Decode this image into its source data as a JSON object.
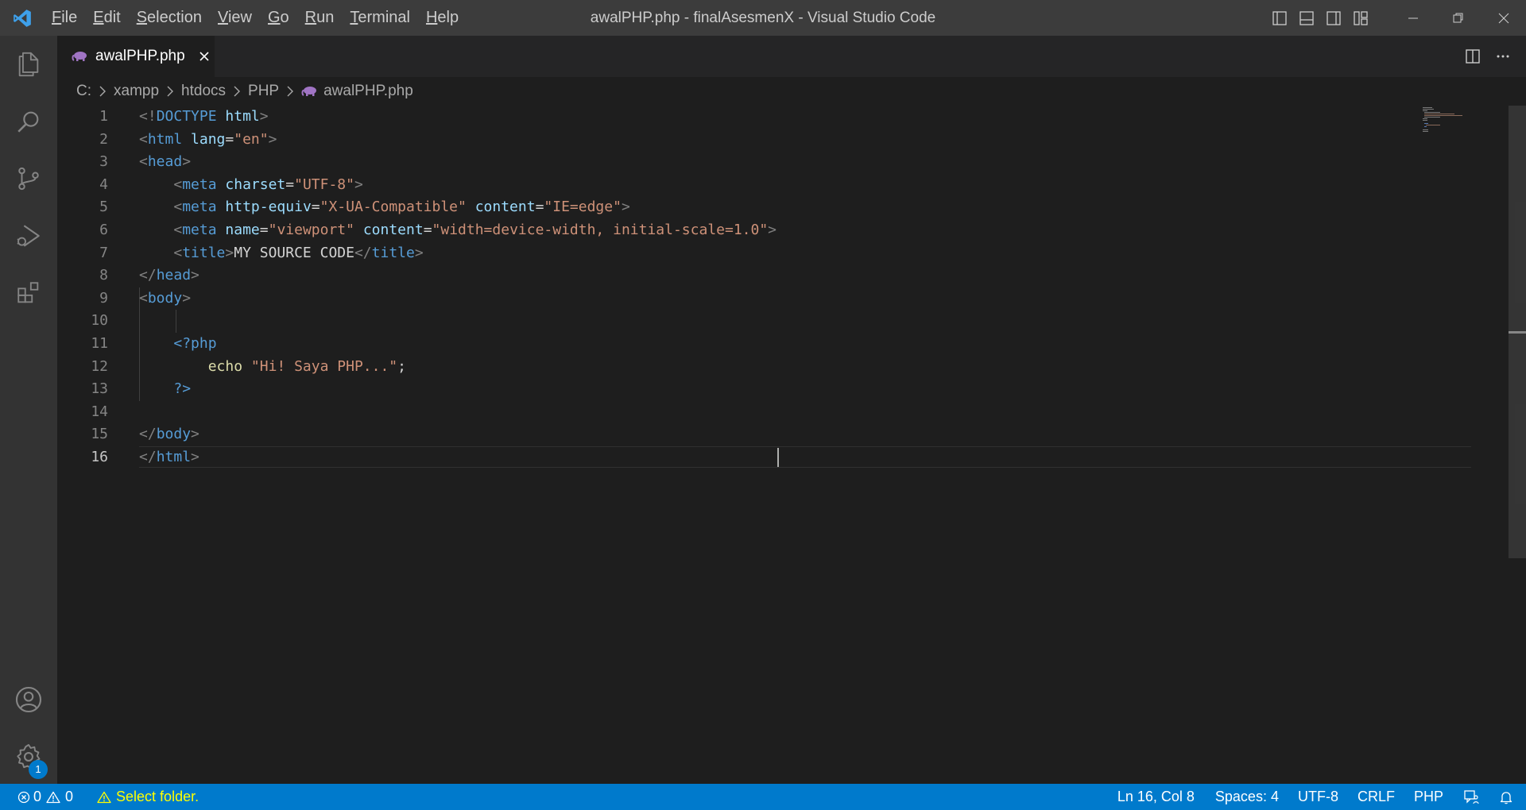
{
  "window": {
    "title": "awalPHP.php - finalAsesmenX - Visual Studio Code"
  },
  "menu": {
    "items": [
      {
        "label": "File",
        "mnemonic": "F",
        "rest": "ile"
      },
      {
        "label": "Edit",
        "mnemonic": "E",
        "rest": "dit"
      },
      {
        "label": "Selection",
        "mnemonic": "S",
        "rest": "election"
      },
      {
        "label": "View",
        "mnemonic": "V",
        "rest": "iew"
      },
      {
        "label": "Go",
        "mnemonic": "G",
        "rest": "o"
      },
      {
        "label": "Run",
        "mnemonic": "R",
        "rest": "un"
      },
      {
        "label": "Terminal",
        "mnemonic": "T",
        "rest": "erminal"
      },
      {
        "label": "Help",
        "mnemonic": "H",
        "rest": "elp"
      }
    ]
  },
  "activity_bar": {
    "icons": [
      "explorer-icon",
      "search-icon",
      "source-control-icon",
      "run-debug-icon",
      "extensions-icon",
      "account-icon",
      "manage-gear-icon"
    ],
    "settings_badge": "1"
  },
  "tab": {
    "label": "awalPHP.php",
    "icon": "php-elephant-icon"
  },
  "breadcrumb": {
    "segments": [
      "C:",
      "xampp",
      "htdocs",
      "PHP",
      "awalPHP.php"
    ]
  },
  "editor": {
    "active_line": 16,
    "line_numbers": [
      "1",
      "2",
      "3",
      "4",
      "5",
      "6",
      "7",
      "8",
      "9",
      "10",
      "11",
      "12",
      "13",
      "14",
      "15",
      "16"
    ],
    "lines": [
      [
        [
          "p",
          "<!"
        ],
        [
          "t",
          "DOCTYPE"
        ],
        [
          "x",
          " "
        ],
        [
          "a",
          "html"
        ],
        [
          "p",
          ">"
        ]
      ],
      [
        [
          "p",
          "<"
        ],
        [
          "t",
          "html"
        ],
        [
          "x",
          " "
        ],
        [
          "a",
          "lang"
        ],
        [
          "x",
          "="
        ],
        [
          "s",
          "\"en\""
        ],
        [
          "p",
          ">"
        ]
      ],
      [
        [
          "p",
          "<"
        ],
        [
          "t",
          "head"
        ],
        [
          "p",
          ">"
        ]
      ],
      [
        [
          "x",
          "    "
        ],
        [
          "p",
          "<"
        ],
        [
          "t",
          "meta"
        ],
        [
          "x",
          " "
        ],
        [
          "a",
          "charset"
        ],
        [
          "x",
          "="
        ],
        [
          "s",
          "\"UTF-8\""
        ],
        [
          "p",
          ">"
        ]
      ],
      [
        [
          "x",
          "    "
        ],
        [
          "p",
          "<"
        ],
        [
          "t",
          "meta"
        ],
        [
          "x",
          " "
        ],
        [
          "a",
          "http-equiv"
        ],
        [
          "x",
          "="
        ],
        [
          "s",
          "\"X-UA-Compatible\""
        ],
        [
          "x",
          " "
        ],
        [
          "a",
          "content"
        ],
        [
          "x",
          "="
        ],
        [
          "s",
          "\"IE=edge\""
        ],
        [
          "p",
          ">"
        ]
      ],
      [
        [
          "x",
          "    "
        ],
        [
          "p",
          "<"
        ],
        [
          "t",
          "meta"
        ],
        [
          "x",
          " "
        ],
        [
          "a",
          "name"
        ],
        [
          "x",
          "="
        ],
        [
          "s",
          "\"viewport\""
        ],
        [
          "x",
          " "
        ],
        [
          "a",
          "content"
        ],
        [
          "x",
          "="
        ],
        [
          "s",
          "\"width=device-width, initial-scale=1.0\""
        ],
        [
          "p",
          ">"
        ]
      ],
      [
        [
          "x",
          "    "
        ],
        [
          "p",
          "<"
        ],
        [
          "t",
          "title"
        ],
        [
          "p",
          ">"
        ],
        [
          "x",
          "MY SOURCE CODE"
        ],
        [
          "p",
          "</"
        ],
        [
          "t",
          "title"
        ],
        [
          "p",
          ">"
        ]
      ],
      [
        [
          "p",
          "</"
        ],
        [
          "t",
          "head"
        ],
        [
          "p",
          ">"
        ]
      ],
      [
        [
          "p",
          "<"
        ],
        [
          "t",
          "body"
        ],
        [
          "p",
          ">"
        ]
      ],
      [
        [
          "x",
          ""
        ]
      ],
      [
        [
          "x",
          "    "
        ],
        [
          "k",
          "<?php"
        ]
      ],
      [
        [
          "x",
          "        "
        ],
        [
          "f",
          "echo"
        ],
        [
          "x",
          " "
        ],
        [
          "s",
          "\"Hi! Saya PHP...\""
        ],
        [
          "x",
          ";"
        ]
      ],
      [
        [
          "x",
          "    "
        ],
        [
          "k",
          "?>"
        ]
      ],
      [
        [
          "x",
          ""
        ]
      ],
      [
        [
          "p",
          "</"
        ],
        [
          "t",
          "body"
        ],
        [
          "p",
          ">"
        ]
      ],
      [
        [
          "p",
          "</"
        ],
        [
          "t",
          "html"
        ],
        [
          "p",
          ">"
        ]
      ]
    ]
  },
  "status_bar": {
    "errors": "0",
    "warnings": "0",
    "folder_message": "Select folder.",
    "position": "Ln 16, Col 8",
    "spaces": "Spaces: 4",
    "encoding": "UTF-8",
    "eol": "CRLF",
    "language": "PHP"
  },
  "colors": {
    "status_bar": "#007acc",
    "folder_warning": "#ffff00"
  }
}
